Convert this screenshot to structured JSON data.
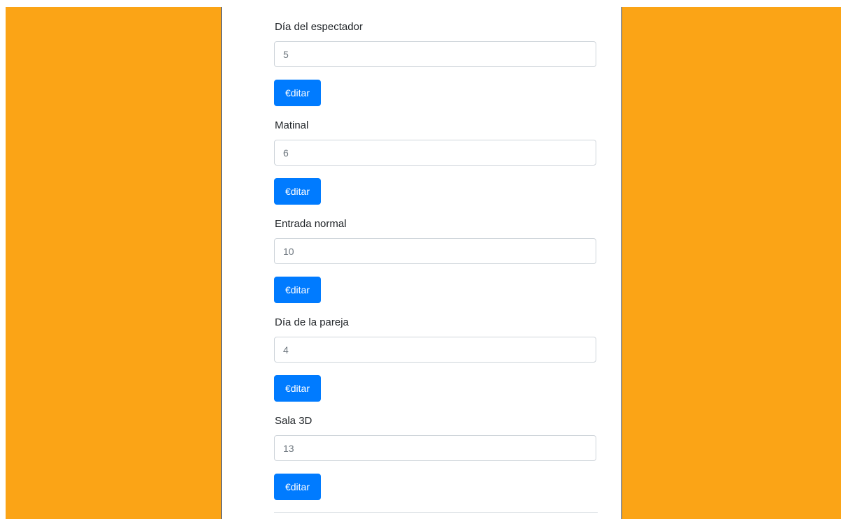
{
  "fields": [
    {
      "label": "Día del espectador",
      "value": "5",
      "button_label": "€ditar"
    },
    {
      "label": "Matinal",
      "value": "6",
      "button_label": "€ditar"
    },
    {
      "label": "Entrada normal",
      "value": "10",
      "button_label": "€ditar"
    },
    {
      "label": "Día de la pareja",
      "value": "4",
      "button_label": "€ditar"
    },
    {
      "label": "Sala 3D",
      "value": "13",
      "button_label": "€ditar"
    }
  ],
  "colors": {
    "side_panel": "#fba416",
    "button": "#007bff",
    "input_border": "#ced4da"
  }
}
